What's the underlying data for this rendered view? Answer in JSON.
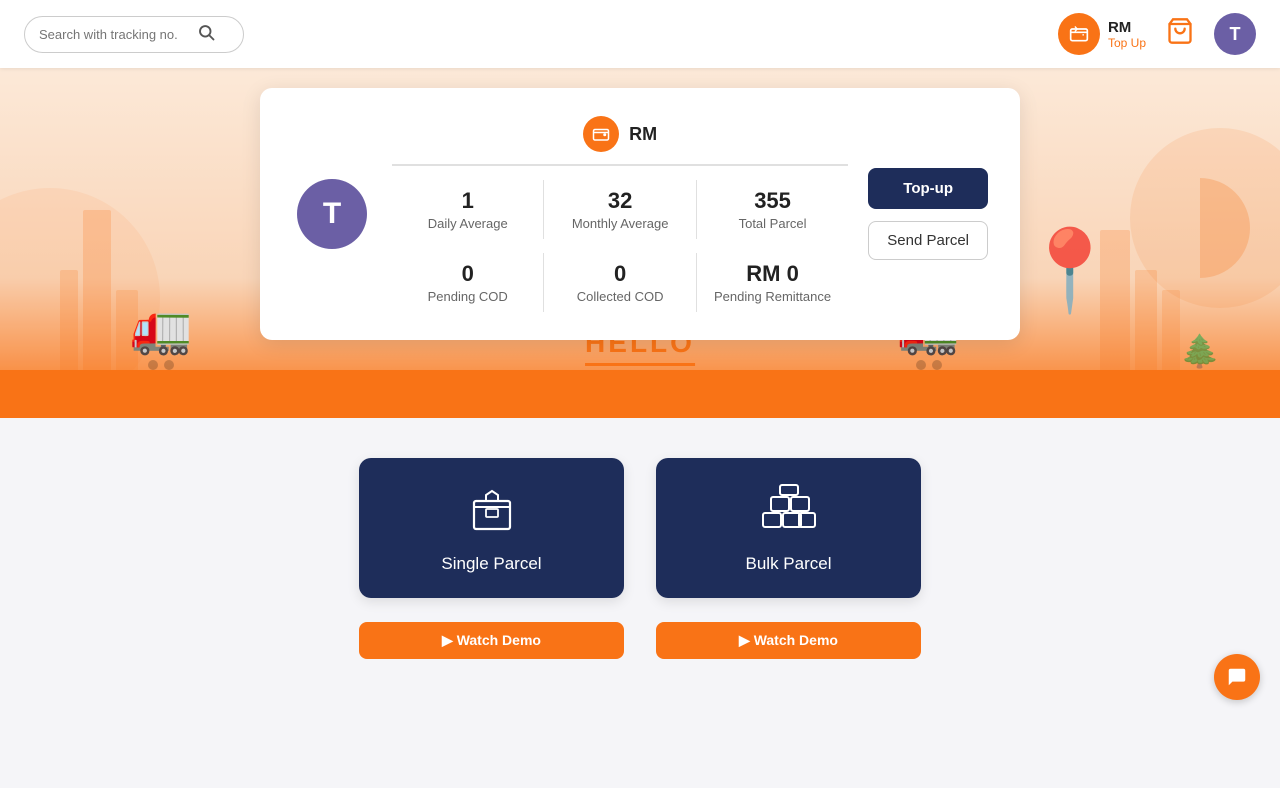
{
  "header": {
    "search_placeholder": "Search with tracking no.",
    "wallet_amount": "RM",
    "topup_label": "Top Up",
    "avatar_initial": "T"
  },
  "dashboard": {
    "wallet_icon_label": "wallet-icon",
    "wallet_amount": "RM",
    "avatar_initial": "T",
    "stats": [
      {
        "value": "1",
        "label": "Daily Average"
      },
      {
        "value": "32",
        "label": "Monthly Average"
      },
      {
        "value": "355",
        "label": "Total Parcel"
      }
    ],
    "stats2": [
      {
        "value": "0",
        "label": "Pending COD"
      },
      {
        "value": "0",
        "label": "Collected COD"
      },
      {
        "value": "RM 0",
        "label": "Pending Remittance"
      }
    ],
    "btn_topup": "Top-up",
    "btn_send": "Send Parcel"
  },
  "hello": {
    "text": "HELLO"
  },
  "parcel_section": {
    "single_parcel": {
      "label": "Single Parcel",
      "watch_demo": "▶  Watch Demo"
    },
    "bulk_parcel": {
      "label": "Bulk Parcel",
      "watch_demo": "▶  Watch Demo"
    }
  },
  "chat": {
    "icon": "💬"
  }
}
